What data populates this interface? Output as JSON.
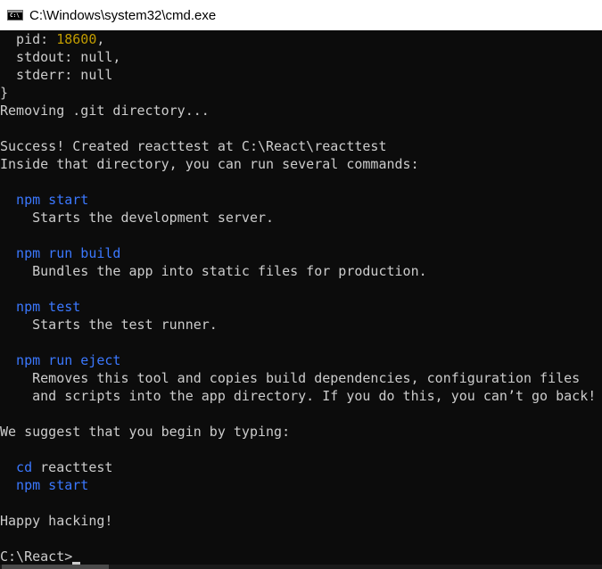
{
  "window": {
    "title": "C:\\Windows\\system32\\cmd.exe",
    "icon_label": "C:\\"
  },
  "console": {
    "l1_key": "  pid: ",
    "l1_val": "18600",
    "l1_tail": ",",
    "l2": "  stdout: null,",
    "l3": "  stderr: null",
    "l4": "}",
    "l5": "Removing .git directory...",
    "l6": "",
    "l7": "Success! Created reacttest at C:\\React\\reacttest",
    "l8": "Inside that directory, you can run several commands:",
    "l9": "",
    "l10": "  npm start",
    "l11": "    Starts the development server.",
    "l12": "",
    "l13": "  npm run build",
    "l14": "    Bundles the app into static files for production.",
    "l15": "",
    "l16": "  npm test",
    "l17": "    Starts the test runner.",
    "l18": "",
    "l19": "  npm run eject",
    "l20": "    Removes this tool and copies build dependencies, configuration files",
    "l21": "    and scripts into the app directory. If you do this, you can’t go back!",
    "l22": "",
    "l23": "We suggest that you begin by typing:",
    "l24": "",
    "l25_cmd": "  cd",
    "l25_arg": " reacttest",
    "l26": "  npm start",
    "l27": "",
    "l28": "Happy hacking!",
    "l29": "",
    "prompt": "C:\\React>"
  },
  "colors": {
    "background": "#0c0c0c",
    "foreground": "#cccccc",
    "command_blue": "#3b78ff",
    "number_yellow": "#c19c00"
  }
}
